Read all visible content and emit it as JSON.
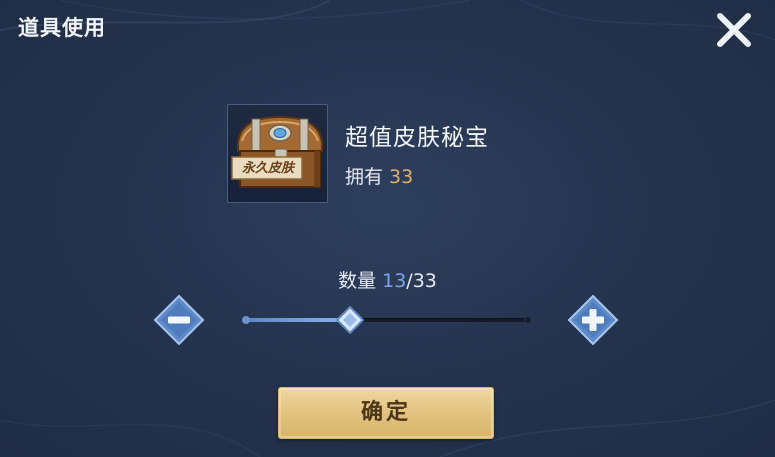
{
  "dialog": {
    "title": "道具使用",
    "close_icon": "close-icon"
  },
  "item": {
    "icon": "treasure-chest-icon",
    "icon_label": "永久皮肤",
    "name": "超值皮肤秘宝",
    "owned_label": "拥有",
    "owned_count": "33"
  },
  "quantity": {
    "label": "数量",
    "current": "13",
    "separator": "/",
    "max": "33",
    "fill_fraction": 0.37,
    "minus_icon": "minus-icon",
    "plus_icon": "plus-icon"
  },
  "confirm_label": "确定",
  "colors": {
    "background": "#25344f",
    "accent_blue": "#79a6ec",
    "owned_gold": "#e3b35a",
    "button_gold": "#e2c37f",
    "button_text": "#4c3417"
  }
}
